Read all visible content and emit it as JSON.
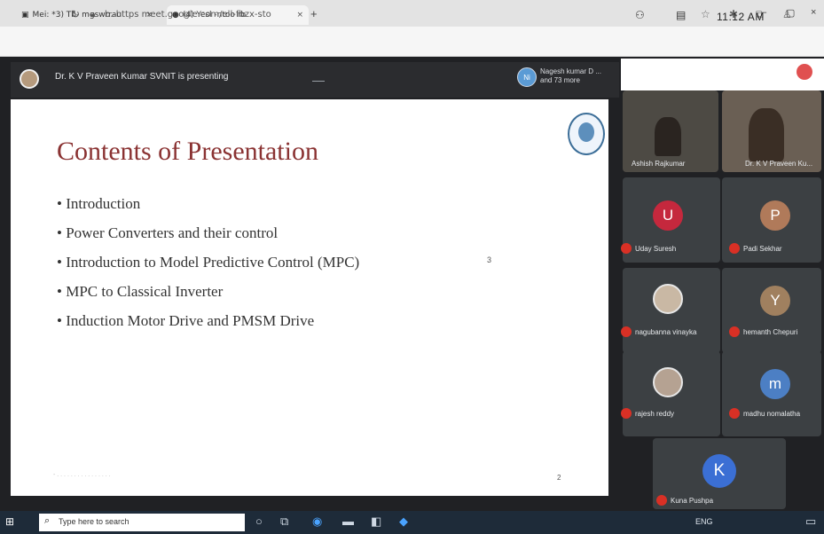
{
  "browser": {
    "tabs": [
      {
        "label": "Mei: *3) Tb- mgswrrau"
      },
      {
        "label": "(4) Yesl -ntoo rb"
      }
    ],
    "new_tab_icon": "plus-icon",
    "url": "b. https  meet.google.com/ell-fbzx-sto"
  },
  "meet": {
    "presenting_text": "Dr. K V Praveen Kumar SVNIT is presenting",
    "presenter_initials": "",
    "raised": {
      "initials": "Ni",
      "text": "Nagesh kumar D ... and 73 more"
    },
    "clock": "11:12 AM"
  },
  "slide": {
    "title": "Contents of Presentation",
    "bullets": [
      "Introduction",
      "Power Converters and their control",
      "Introduction to Model Predictive Control (MPC)",
      "MPC to Classical Inverter",
      "Induction Motor Drive and PMSM Drive"
    ],
    "note": "3",
    "footer": "- . . . . . . . . . . . . . . . .",
    "page": "2"
  },
  "participants": [
    {
      "name": "Ashish Rajkumar",
      "initial": "",
      "color": "#4d4a44"
    },
    {
      "name": "Dr. K V Praveen Ku...",
      "initial": "",
      "color": "#4d4a44"
    },
    {
      "name": "Uday Suresh",
      "initial": "U",
      "color": "#c5283d"
    },
    {
      "name": "Padi Sekhar",
      "initial": "P",
      "color": "#b07a5a"
    },
    {
      "name": "nagubanna vinayka",
      "initial": "",
      "color": ""
    },
    {
      "name": "hemanth Chepuri",
      "initial": "Y",
      "color": "#a0805f"
    },
    {
      "name": "rajesh reddy",
      "initial": "",
      "color": ""
    },
    {
      "name": "madhu nomalatha",
      "initial": "m",
      "color": "#4c7fc4"
    },
    {
      "name": "Kuna Pushpa",
      "initial": "K",
      "color": "#3b6fd4"
    }
  ],
  "taskbar": {
    "search_placeholder": "Type here to search",
    "tray_text": "ENG"
  }
}
